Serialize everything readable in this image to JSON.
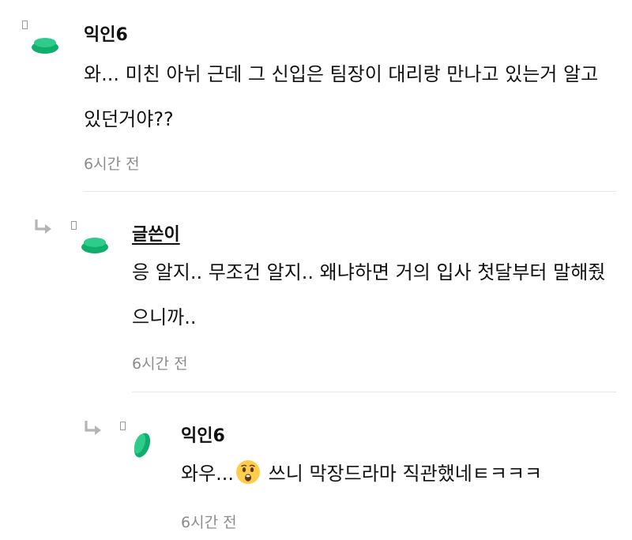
{
  "comments": [
    {
      "author": "익인6",
      "text": "와... 미친 아뉘 근데 그 신입은 팀장이 대리랑 만나고 있는거 알고 있던거야??",
      "time": "6시간 전"
    },
    {
      "author": "글쓴이",
      "text": "응 알지.. 무조건 알지.. 왜냐하면 거의 입사 첫달부터 말해줬으니까..",
      "time": "6시간 전"
    },
    {
      "author": "익인6",
      "text_before_emoji": "와우...",
      "emoji": "surprised-face",
      "text_after_emoji": " 쓰니 막장드라마 직관했네ㅌㅋㅋㅋ",
      "time": "6시간 전"
    }
  ],
  "colors": {
    "avatar_green": "#2ecc8a",
    "avatar_dark_green": "#0fae6b",
    "divider": "#e6e6e6",
    "meta_gray": "#8c8c8c",
    "emoji_yellow": "#ffcc4d"
  }
}
